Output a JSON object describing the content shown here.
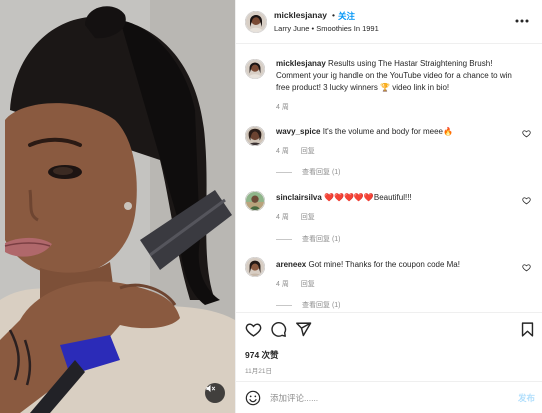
{
  "post": {
    "username": "micklesjanay",
    "follow_dot": "•",
    "follow_label": "关注",
    "subtitle": "Larry June • Smoothies In 1991"
  },
  "caption": {
    "username": "micklesjanay",
    "text": "Results using The Hastar Straightening Brush! Comment your ig handle on the YouTube video for a chance to win free product! 3 lucky winners 🏆 video link in bio!",
    "time": "4 周"
  },
  "comments": [
    {
      "username": "wavy_spice",
      "text": "It's the volume and body for meee🔥",
      "time": "4 周",
      "reply_label": "回复",
      "view_replies": "查看回复 (1)"
    },
    {
      "username": "sinclairsilva",
      "text": "❤️❤️❤️❤️❤️Beautiful!!!",
      "time": "4 周",
      "reply_label": "回复",
      "view_replies": "查看回复 (1)"
    },
    {
      "username": "areneex",
      "text": "Got mine! Thanks for the coupon code Ma!",
      "time": "4 周",
      "reply_label": "回复",
      "view_replies": "查看回复 (1)"
    }
  ],
  "stats": {
    "likes": "974 次赞",
    "date": "11月21日"
  },
  "add_comment": {
    "placeholder": "添加评论......",
    "post_label": "发布"
  },
  "icons": {
    "more": "more-horizontal-icon",
    "like": "heart-icon",
    "comment": "comment-icon",
    "share": "share-icon",
    "save": "bookmark-icon",
    "emoji": "emoji-icon",
    "mute": "mute-icon"
  },
  "colors": {
    "link_blue": "#0095f6",
    "post_disabled": "#b2dffc",
    "secondary_text": "#8e8e8e"
  }
}
